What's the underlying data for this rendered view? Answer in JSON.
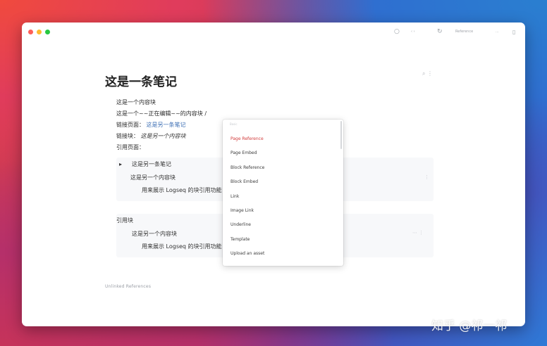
{
  "window": {
    "traffic_lights": [
      "close",
      "minimize",
      "maximize"
    ]
  },
  "topbar": {
    "icons": [
      "search-icon",
      "refresh-icon"
    ],
    "graph_label": "Reference",
    "more_label": "..."
  },
  "page": {
    "title": "这是一条笔记",
    "blocks": [
      {
        "prefix": "这是一个内容块",
        "value": ""
      },
      {
        "prefix": "这是一个~~正在编辑~~的内容块 /",
        "value": ""
      },
      {
        "prefix": "链接页面：",
        "value": "这是另一条笔记"
      },
      {
        "prefix": "链接块：",
        "value": "这是另一个内容块"
      },
      {
        "prefix": "引用页面：",
        "value": ""
      }
    ]
  },
  "linked_refs": [
    {
      "page": "这是另一条笔记",
      "line1": "这是另一个内容块",
      "line2": "用来展示 Logseq 的块引用功能"
    },
    {
      "page": "引用块",
      "line1": "这是另一个内容块",
      "line2": "用来展示 Logseq 的块引用功能"
    }
  ],
  "unlinked_label": "Unlinked References",
  "dropdown": {
    "hint": "Basic",
    "items": [
      "Page Reference",
      "Page Embed",
      "Block Reference",
      "Block Embed",
      "Link",
      "Image Link",
      "Underline",
      "Template",
      "Upload an asset"
    ],
    "active_index": 0
  },
  "watermark": "知乎 @祁一祁",
  "colors": {
    "link": "#3d6fb4",
    "active_item": "#d23b3b",
    "window_bg": "#ffffff"
  }
}
